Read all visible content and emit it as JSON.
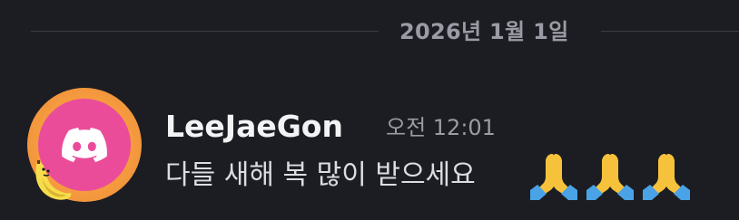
{
  "divider": {
    "date": "2026년 1월 1일"
  },
  "message": {
    "author": "LeeJaeGon",
    "timestamp": "오전 12:01",
    "text": "다들 새해 복 많이 받으세요",
    "emojis": [
      "folded-hands-icon",
      "folded-hands-icon",
      "folded-hands-icon"
    ]
  },
  "avatar": {
    "icon": "discord-logo-icon",
    "decoration": "banana-icon"
  },
  "colors": {
    "background": "#1c1d22",
    "avatar_ring": "#f59a3f",
    "avatar_fill": "#ea4c9a",
    "muted_text": "#9a9ca5",
    "author_text": "#f2f3f5"
  }
}
